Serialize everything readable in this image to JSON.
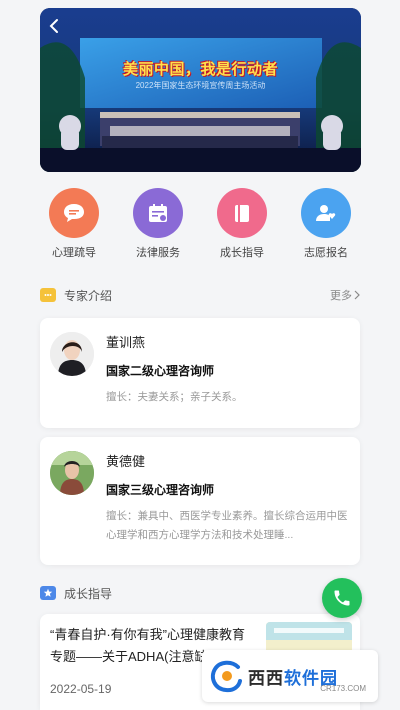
{
  "banner": {
    "title": "美丽中国，我是行动者",
    "subtitle": "2022年国家生态环境宣传周主场活动"
  },
  "menu": [
    {
      "label": "心理疏导",
      "icon": "chat-icon",
      "color": "#f37a55"
    },
    {
      "label": "法律服务",
      "icon": "calendar-icon",
      "color": "#8a6ad6"
    },
    {
      "label": "成长指导",
      "icon": "book-icon",
      "color": "#f06a8c"
    },
    {
      "label": "志愿报名",
      "icon": "user-heart-icon",
      "color": "#4ba3f0"
    }
  ],
  "experts_section": {
    "title": "专家介绍",
    "more": "更多"
  },
  "experts": [
    {
      "name": "董训燕",
      "title": "国家二级心理咨询师",
      "desc": "擅长：夫妻关系；亲子关系。"
    },
    {
      "name": "黄德健",
      "title": "国家三级心理咨询师",
      "desc": "擅长：兼具中、西医学专业素养。擅长综合运用中医心理学和西方心理学方法和技术处理睡..."
    }
  ],
  "growth_section": {
    "title": "成长指导"
  },
  "articles": [
    {
      "title": "“青春自护·有你有我”心理健康教育专题——关于ADHA(注意缺...",
      "date": "2022-05-19"
    }
  ],
  "watermark": {
    "main_a": "西西",
    "main_b": "软件园",
    "sub": "CR173.COM"
  },
  "colors": {
    "phone": "#23c05c",
    "accent": "#1e6fd9"
  }
}
